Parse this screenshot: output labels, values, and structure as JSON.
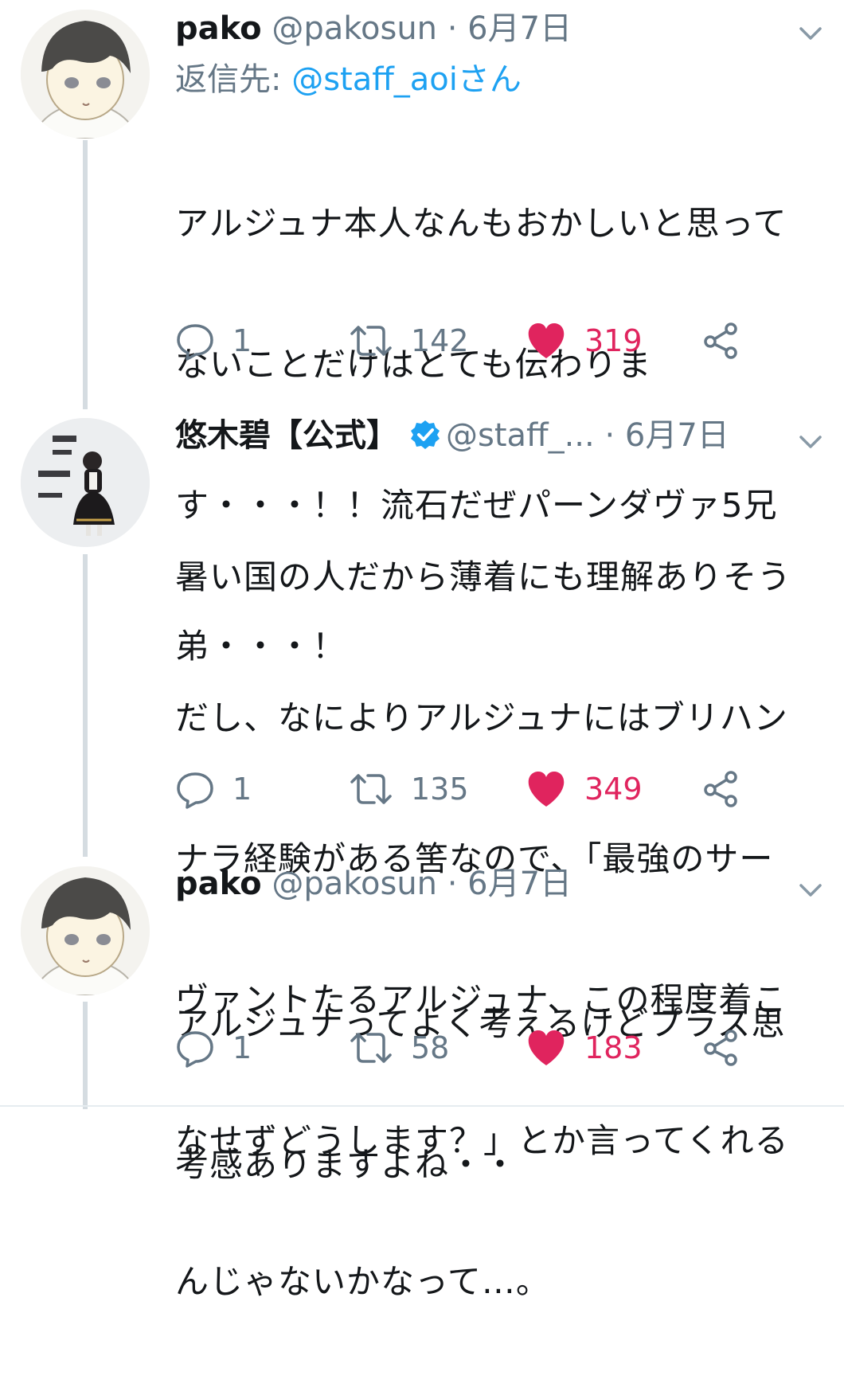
{
  "colors": {
    "accent": "#1da1f2",
    "muted": "#657786",
    "like": "#e0245e",
    "thread": "#d5dce1"
  },
  "tweets": [
    {
      "name": "pako",
      "handle": "@pakosun",
      "sep": "·",
      "date": "6月7日",
      "reply_prefix": "返信先: ",
      "reply_mention": "@staff_aoiさん",
      "text_lines": [
        "アルジュナ本人なんもおかしいと思って",
        "ないことだけはとても伝わりま",
        "す・・・！！流石だぜパーンダヴァ5兄",
        "弟・・・！"
      ],
      "replies": "1",
      "retweets": "142",
      "likes": "319",
      "avatar_icon": "illustrated-boy-avatar"
    },
    {
      "name": "悠木碧【公式】",
      "verified": true,
      "handle": "@staff_...",
      "sep": "·",
      "date": "6月7日",
      "text_lines": [
        "暑い国の人だから薄着にも理解ありそう",
        "だし、なによりアルジュナにはブリハン",
        "ナラ経験がある筈なので、「最強のサー",
        "ヴァントたるアルジュナ、この程度着こ",
        "なせずどうします？」とか言ってくれる",
        "んじゃないかなって…。"
      ],
      "replies": "1",
      "retweets": "135",
      "likes": "349",
      "avatar_icon": "photo-person-avatar"
    },
    {
      "name": "pako",
      "handle": "@pakosun",
      "sep": "·",
      "date": "6月7日",
      "text_lines": [
        "アルジュナってよく考えるけどプラス思",
        "考感ありますよね・・"
      ],
      "replies": "1",
      "retweets": "58",
      "likes": "183",
      "avatar_icon": "illustrated-boy-avatar"
    }
  ]
}
